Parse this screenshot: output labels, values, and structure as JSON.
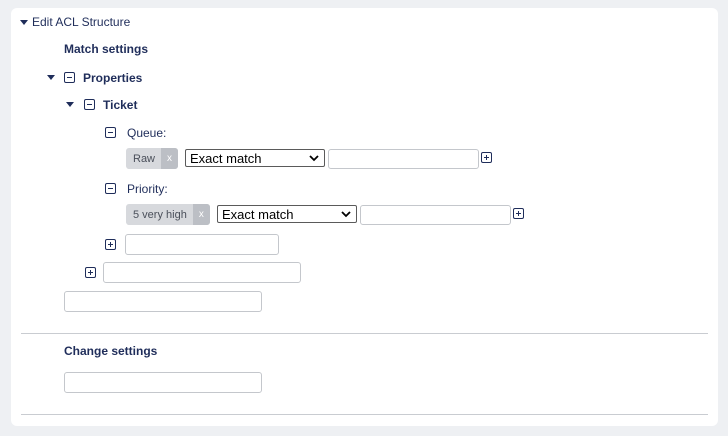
{
  "header": {
    "title": "Edit ACL Structure"
  },
  "match": {
    "title": "Match settings",
    "properties_label": "Properties",
    "ticket_label": "Ticket",
    "queue": {
      "label": "Queue:",
      "tag": "Raw",
      "tag_remove": "x",
      "operator": "Exact match",
      "value": ""
    },
    "priority": {
      "label": "Priority:",
      "tag": "5 very high",
      "tag_remove": "x",
      "operator": "Exact match",
      "value": ""
    }
  },
  "change": {
    "title": "Change settings"
  }
}
